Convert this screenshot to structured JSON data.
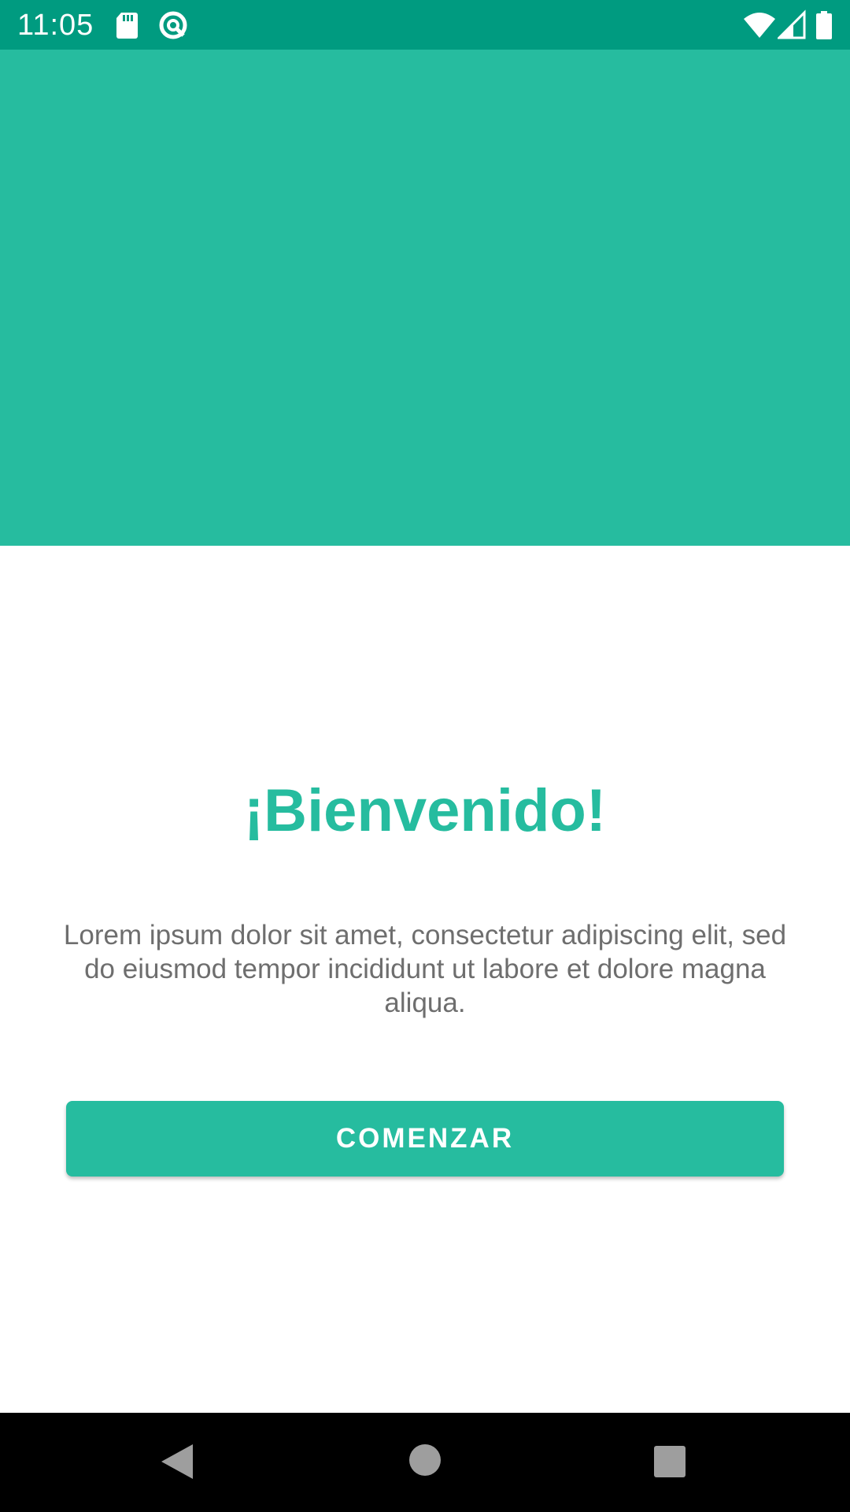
{
  "status_bar": {
    "time": "11:05",
    "icons": [
      "sd-card-icon",
      "recording-icon",
      "wifi-icon",
      "signal-icon",
      "battery-icon"
    ],
    "background_color": "#009b80"
  },
  "hero": {
    "background_color": "#26bc9f"
  },
  "welcome": {
    "title": "¡Bienvenido!",
    "description": "Lorem ipsum dolor sit amet, consectetur adipiscing elit, sed do eiusmod tempor incididunt ut labore et dolore magna aliqua.",
    "start_button_label": "COMENZAR",
    "accent_color": "#26bc9f"
  },
  "navigation": {
    "buttons": [
      "back-icon",
      "home-icon",
      "recents-icon"
    ]
  }
}
